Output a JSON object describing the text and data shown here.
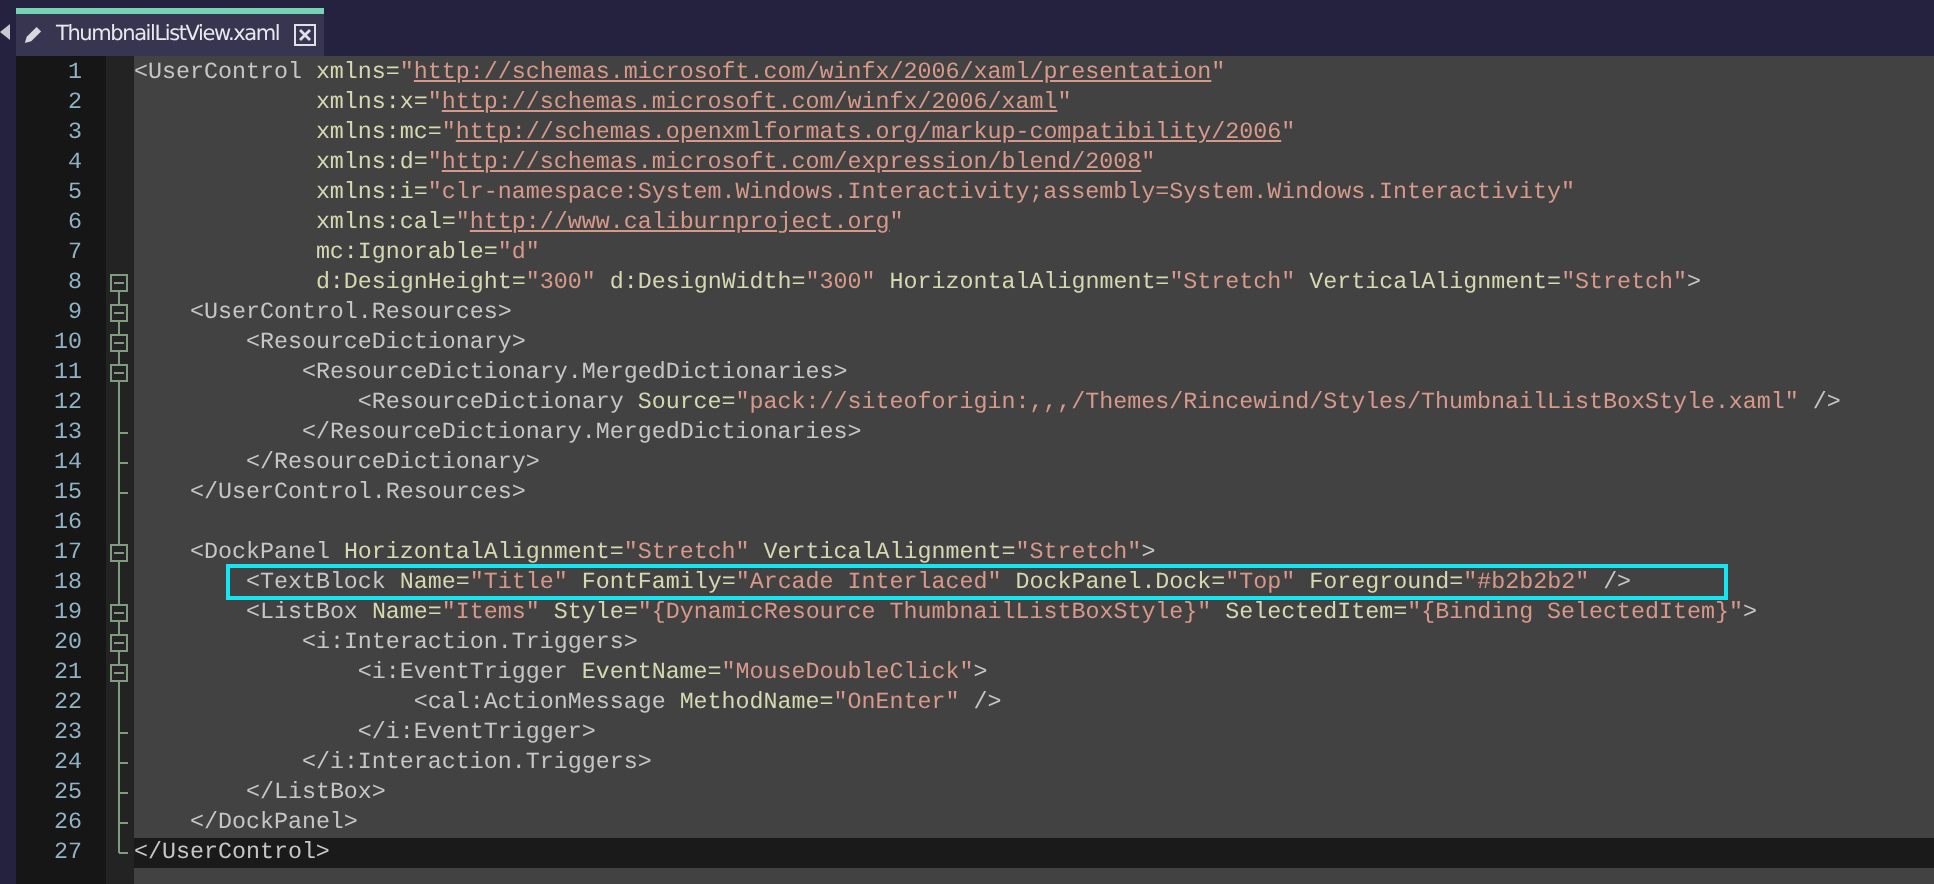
{
  "tab": {
    "title": "ThumbnailListView.xaml",
    "selected": true,
    "modified": true
  },
  "lines": [
    {
      "number": "1",
      "collapsible": false,
      "block_end": false,
      "current": false,
      "highlighted": false,
      "tokens": [
        {
          "kind": "tag",
          "text": "<UserControl "
        },
        {
          "kind": "attr",
          "text": "xmlns="
        },
        {
          "kind": "value",
          "text": "\""
        },
        {
          "kind": "link",
          "text": "http://schemas.microsoft.com/winfx/2006/xaml/presentation"
        },
        {
          "kind": "value",
          "text": "\""
        }
      ]
    },
    {
      "number": "2",
      "collapsible": false,
      "block_end": false,
      "current": false,
      "highlighted": false,
      "tokens": [
        {
          "kind": "attr",
          "text": "             xmlns:x="
        },
        {
          "kind": "value",
          "text": "\""
        },
        {
          "kind": "link",
          "text": "http://schemas.microsoft.com/winfx/2006/xaml"
        },
        {
          "kind": "value",
          "text": "\""
        }
      ]
    },
    {
      "number": "3",
      "collapsible": false,
      "block_end": false,
      "current": false,
      "highlighted": false,
      "tokens": [
        {
          "kind": "attr",
          "text": "             xmlns:mc="
        },
        {
          "kind": "value",
          "text": "\""
        },
        {
          "kind": "link",
          "text": "http://schemas.openxmlformats.org/markup-compatibility/2006"
        },
        {
          "kind": "value",
          "text": "\""
        }
      ]
    },
    {
      "number": "4",
      "collapsible": false,
      "block_end": false,
      "current": false,
      "highlighted": false,
      "tokens": [
        {
          "kind": "attr",
          "text": "             xmlns:d="
        },
        {
          "kind": "value",
          "text": "\""
        },
        {
          "kind": "link",
          "text": "http://schemas.microsoft.com/expression/blend/2008"
        },
        {
          "kind": "value",
          "text": "\""
        }
      ]
    },
    {
      "number": "5",
      "collapsible": false,
      "block_end": false,
      "current": false,
      "highlighted": false,
      "tokens": [
        {
          "kind": "attr",
          "text": "             xmlns:i="
        },
        {
          "kind": "value",
          "text": "\"clr-namespace:System.Windows.Interactivity;assembly=System.Windows.Interactivity\""
        }
      ]
    },
    {
      "number": "6",
      "collapsible": false,
      "block_end": false,
      "current": false,
      "highlighted": false,
      "tokens": [
        {
          "kind": "attr",
          "text": "             xmlns:cal="
        },
        {
          "kind": "value",
          "text": "\""
        },
        {
          "kind": "link",
          "text": "http://www.caliburnproject.org"
        },
        {
          "kind": "value",
          "text": "\""
        }
      ]
    },
    {
      "number": "7",
      "collapsible": false,
      "block_end": false,
      "current": false,
      "highlighted": false,
      "tokens": [
        {
          "kind": "attr",
          "text": "             mc:Ignorable="
        },
        {
          "kind": "value",
          "text": "\"d\""
        }
      ]
    },
    {
      "number": "8",
      "collapsible": true,
      "block_end": false,
      "current": false,
      "highlighted": false,
      "tokens": [
        {
          "kind": "attr",
          "text": "             d:DesignHeight="
        },
        {
          "kind": "value",
          "text": "\"300\" "
        },
        {
          "kind": "attr",
          "text": "d:DesignWidth="
        },
        {
          "kind": "value",
          "text": "\"300\" "
        },
        {
          "kind": "attr",
          "text": "HorizontalAlignment="
        },
        {
          "kind": "value",
          "text": "\"Stretch\" "
        },
        {
          "kind": "attr",
          "text": "VerticalAlignment="
        },
        {
          "kind": "value",
          "text": "\"Stretch\""
        },
        {
          "kind": "tag",
          "text": ">"
        }
      ]
    },
    {
      "number": "9",
      "collapsible": true,
      "block_end": false,
      "current": false,
      "highlighted": false,
      "tokens": [
        {
          "kind": "tag",
          "text": "    <UserControl.Resources>"
        }
      ]
    },
    {
      "number": "10",
      "collapsible": true,
      "block_end": false,
      "current": false,
      "highlighted": false,
      "tokens": [
        {
          "kind": "tag",
          "text": "        <ResourceDictionary>"
        }
      ]
    },
    {
      "number": "11",
      "collapsible": true,
      "block_end": false,
      "current": false,
      "highlighted": false,
      "tokens": [
        {
          "kind": "tag",
          "text": "            <ResourceDictionary.MergedDictionaries>"
        }
      ]
    },
    {
      "number": "12",
      "collapsible": false,
      "block_end": false,
      "current": false,
      "highlighted": false,
      "tokens": [
        {
          "kind": "tag",
          "text": "                <ResourceDictionary "
        },
        {
          "kind": "attr",
          "text": "Source="
        },
        {
          "kind": "value",
          "text": "\"pack://siteoforigin:,,,/Themes/Rincewind/Styles/ThumbnailListBoxStyle.xaml\" "
        },
        {
          "kind": "tag",
          "text": "/>"
        }
      ]
    },
    {
      "number": "13",
      "collapsible": false,
      "block_end": true,
      "current": false,
      "highlighted": false,
      "tokens": [
        {
          "kind": "tag",
          "text": "            </ResourceDictionary.MergedDictionaries>"
        }
      ]
    },
    {
      "number": "14",
      "collapsible": false,
      "block_end": true,
      "current": false,
      "highlighted": false,
      "tokens": [
        {
          "kind": "tag",
          "text": "        </ResourceDictionary>"
        }
      ]
    },
    {
      "number": "15",
      "collapsible": false,
      "block_end": true,
      "current": false,
      "highlighted": false,
      "tokens": [
        {
          "kind": "tag",
          "text": "    </UserControl.Resources>"
        }
      ]
    },
    {
      "number": "16",
      "collapsible": false,
      "block_end": false,
      "current": false
    },
    {
      "number": "17",
      "collapsible": true,
      "block_end": false,
      "current": false,
      "highlighted": false,
      "tokens": [
        {
          "kind": "tag",
          "text": "    <DockPanel "
        },
        {
          "kind": "attr",
          "text": "HorizontalAlignment="
        },
        {
          "kind": "value",
          "text": "\"Stretch\" "
        },
        {
          "kind": "attr",
          "text": "VerticalAlignment="
        },
        {
          "kind": "value",
          "text": "\"Stretch\""
        },
        {
          "kind": "tag",
          "text": ">"
        }
      ]
    },
    {
      "number": "18",
      "collapsible": false,
      "block_end": false,
      "current": false,
      "highlighted": true,
      "tokens": [
        {
          "kind": "tag",
          "text": "        <TextBlock "
        },
        {
          "kind": "attr",
          "text": "Name="
        },
        {
          "kind": "value",
          "text": "\"Title\" "
        },
        {
          "kind": "attr",
          "text": "FontFamily="
        },
        {
          "kind": "value",
          "text": "\"Arcade Interlaced\" "
        },
        {
          "kind": "attr",
          "text": "DockPanel.Dock="
        },
        {
          "kind": "value",
          "text": "\"Top\" "
        },
        {
          "kind": "attr",
          "text": "Foreground="
        },
        {
          "kind": "value",
          "text": "\"#b2b2b2\" "
        },
        {
          "kind": "tag",
          "text": "/>"
        }
      ]
    },
    {
      "number": "19",
      "collapsible": true,
      "block_end": false,
      "current": false,
      "highlighted": false,
      "tokens": [
        {
          "kind": "tag",
          "text": "        <ListBox "
        },
        {
          "kind": "attr",
          "text": "Name="
        },
        {
          "kind": "value",
          "text": "\"Items\" "
        },
        {
          "kind": "attr",
          "text": "Style="
        },
        {
          "kind": "value",
          "text": "\"{DynamicResource ThumbnailListBoxStyle}\" "
        },
        {
          "kind": "attr",
          "text": "SelectedItem="
        },
        {
          "kind": "value",
          "text": "\"{Binding SelectedItem}\""
        },
        {
          "kind": "tag",
          "text": ">"
        }
      ]
    },
    {
      "number": "20",
      "collapsible": true,
      "block_end": false,
      "current": false,
      "highlighted": false,
      "tokens": [
        {
          "kind": "tag",
          "text": "            <i:Interaction.Triggers>"
        }
      ]
    },
    {
      "number": "21",
      "collapsible": true,
      "block_end": false,
      "current": false,
      "highlighted": false,
      "tokens": [
        {
          "kind": "tag",
          "text": "                <i:EventTrigger "
        },
        {
          "kind": "attr",
          "text": "EventName="
        },
        {
          "kind": "value",
          "text": "\"MouseDoubleClick\""
        },
        {
          "kind": "tag",
          "text": ">"
        }
      ]
    },
    {
      "number": "22",
      "collapsible": false,
      "block_end": false,
      "current": false,
      "highlighted": false,
      "tokens": [
        {
          "kind": "tag",
          "text": "                    <cal:ActionMessage "
        },
        {
          "kind": "attr",
          "text": "MethodName="
        },
        {
          "kind": "value",
          "text": "\"OnEnter\" "
        },
        {
          "kind": "tag",
          "text": "/>"
        }
      ]
    },
    {
      "number": "23",
      "collapsible": false,
      "block_end": true,
      "current": false,
      "highlighted": false,
      "tokens": [
        {
          "kind": "tag",
          "text": "                </i:EventTrigger>"
        }
      ]
    },
    {
      "number": "24",
      "collapsible": false,
      "block_end": true,
      "current": false,
      "highlighted": false,
      "tokens": [
        {
          "kind": "tag",
          "text": "            </i:Interaction.Triggers>"
        }
      ]
    },
    {
      "number": "25",
      "collapsible": false,
      "block_end": true,
      "current": false,
      "highlighted": false,
      "tokens": [
        {
          "kind": "tag",
          "text": "        </ListBox>"
        }
      ]
    },
    {
      "number": "26",
      "collapsible": false,
      "block_end": true,
      "current": false,
      "highlighted": false,
      "tokens": [
        {
          "kind": "tag",
          "text": "    </DockPanel>"
        }
      ]
    },
    {
      "number": "27",
      "collapsible": false,
      "block_end": true,
      "current": true,
      "highlighted": false,
      "tokens": [
        {
          "kind": "tag",
          "text": "</UserControl>"
        }
      ]
    }
  ]
}
